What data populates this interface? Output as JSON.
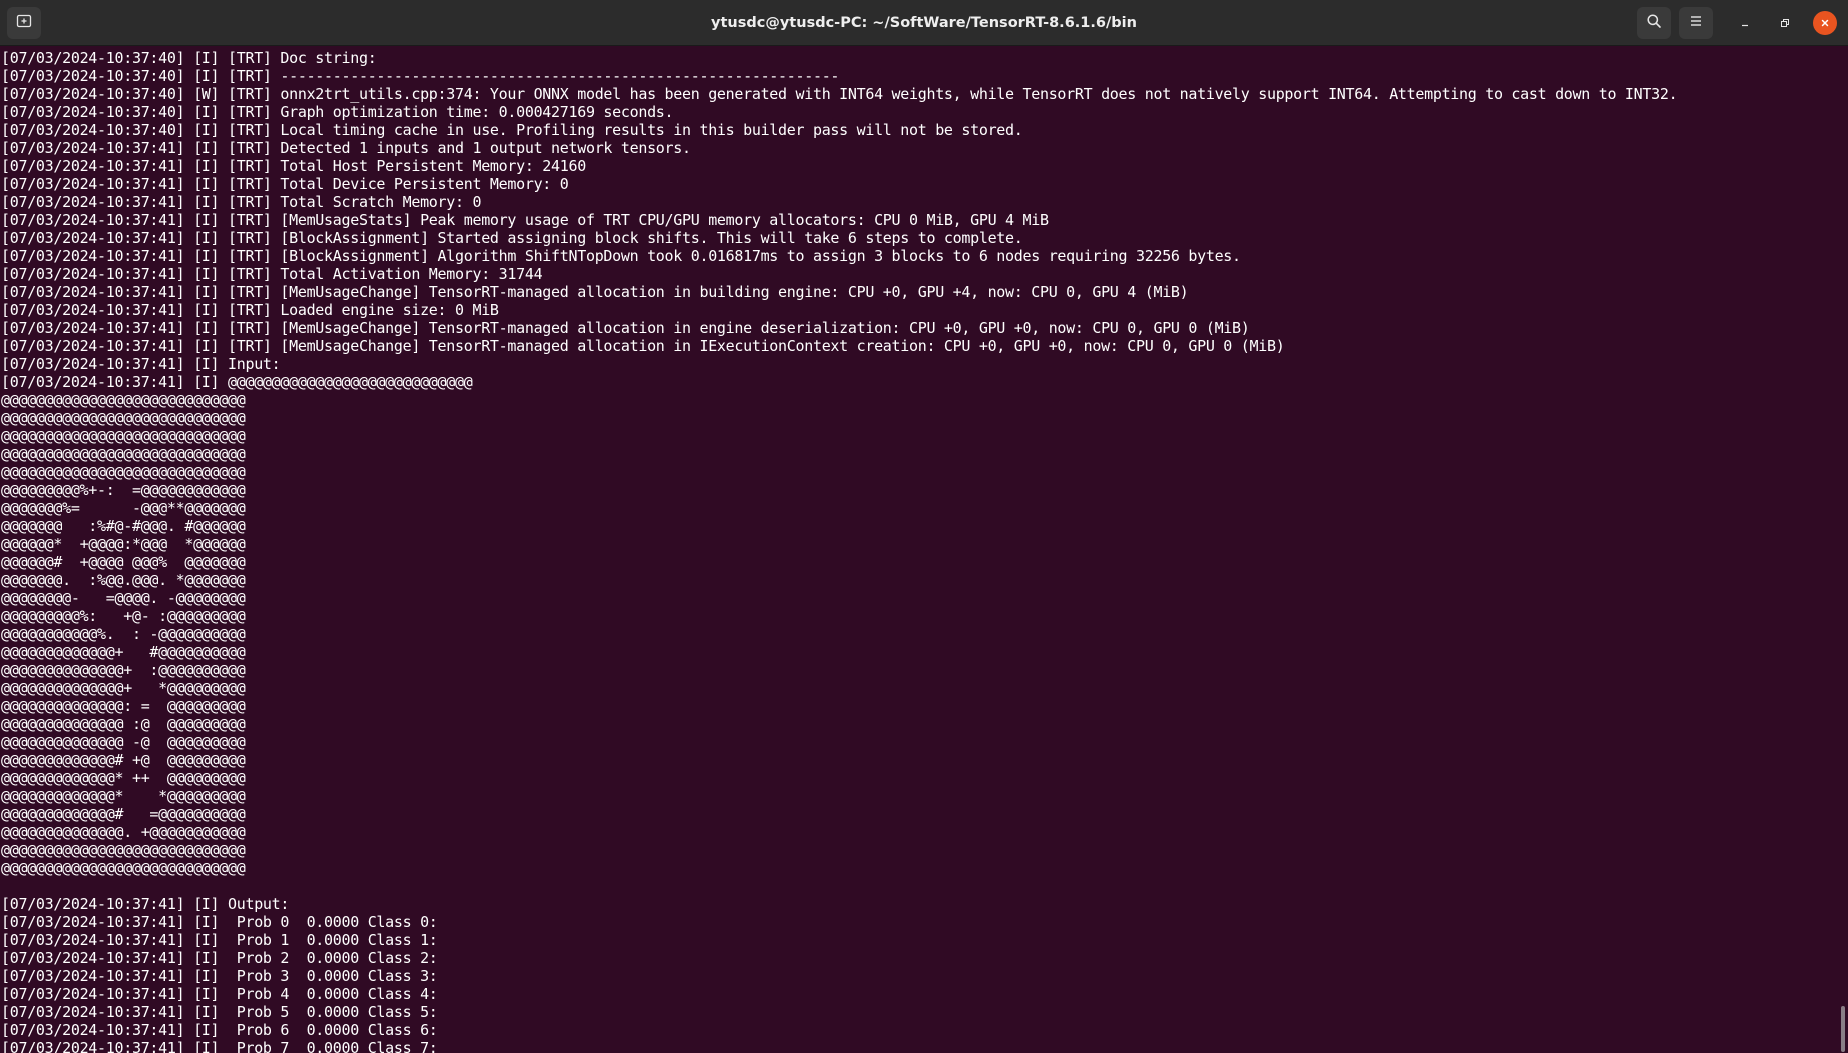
{
  "window": {
    "title": "ytusdc@ytusdc-PC: ~/SoftWare/TensorRT-8.6.1.6/bin"
  },
  "icons": {
    "new_tab": "new-tab-icon",
    "search": "search-icon",
    "menu": "hamburger-menu-icon",
    "minimize": "minimize-icon",
    "maximize": "maximize-icon",
    "close": "close-icon"
  },
  "colors": {
    "terminal_background": "#300a24",
    "titlebar_background": "#2c2c2c",
    "text": "#ffffff",
    "close_button": "#e95420"
  },
  "terminal": {
    "lines": [
      "[07/03/2024-10:37:40] [I] [TRT] Doc string:",
      "[07/03/2024-10:37:40] [I] [TRT] ----------------------------------------------------------------",
      "[07/03/2024-10:37:40] [W] [TRT] onnx2trt_utils.cpp:374: Your ONNX model has been generated with INT64 weights, while TensorRT does not natively support INT64. Attempting to cast down to INT32.",
      "[07/03/2024-10:37:40] [I] [TRT] Graph optimization time: 0.000427169 seconds.",
      "[07/03/2024-10:37:40] [I] [TRT] Local timing cache in use. Profiling results in this builder pass will not be stored.",
      "[07/03/2024-10:37:41] [I] [TRT] Detected 1 inputs and 1 output network tensors.",
      "[07/03/2024-10:37:41] [I] [TRT] Total Host Persistent Memory: 24160",
      "[07/03/2024-10:37:41] [I] [TRT] Total Device Persistent Memory: 0",
      "[07/03/2024-10:37:41] [I] [TRT] Total Scratch Memory: 0",
      "[07/03/2024-10:37:41] [I] [TRT] [MemUsageStats] Peak memory usage of TRT CPU/GPU memory allocators: CPU 0 MiB, GPU 4 MiB",
      "[07/03/2024-10:37:41] [I] [TRT] [BlockAssignment] Started assigning block shifts. This will take 6 steps to complete.",
      "[07/03/2024-10:37:41] [I] [TRT] [BlockAssignment] Algorithm ShiftNTopDown took 0.016817ms to assign 3 blocks to 6 nodes requiring 32256 bytes.",
      "[07/03/2024-10:37:41] [I] [TRT] Total Activation Memory: 31744",
      "[07/03/2024-10:37:41] [I] [TRT] [MemUsageChange] TensorRT-managed allocation in building engine: CPU +0, GPU +4, now: CPU 0, GPU 4 (MiB)",
      "[07/03/2024-10:37:41] [I] [TRT] Loaded engine size: 0 MiB",
      "[07/03/2024-10:37:41] [I] [TRT] [MemUsageChange] TensorRT-managed allocation in engine deserialization: CPU +0, GPU +0, now: CPU 0, GPU 0 (MiB)",
      "[07/03/2024-10:37:41] [I] [TRT] [MemUsageChange] TensorRT-managed allocation in IExecutionContext creation: CPU +0, GPU +0, now: CPU 0, GPU 0 (MiB)",
      "[07/03/2024-10:37:41] [I] Input:",
      "[07/03/2024-10:37:41] [I] @@@@@@@@@@@@@@@@@@@@@@@@@@@@",
      "@@@@@@@@@@@@@@@@@@@@@@@@@@@@",
      "@@@@@@@@@@@@@@@@@@@@@@@@@@@@",
      "@@@@@@@@@@@@@@@@@@@@@@@@@@@@",
      "@@@@@@@@@@@@@@@@@@@@@@@@@@@@",
      "@@@@@@@@@@@@@@@@@@@@@@@@@@@@",
      "@@@@@@@@@%+-:  =@@@@@@@@@@@@",
      "@@@@@@@%=      -@@@**@@@@@@@",
      "@@@@@@@   :%#@-#@@@. #@@@@@@",
      "@@@@@@*  +@@@@:*@@@  *@@@@@@",
      "@@@@@@#  +@@@@ @@@%  @@@@@@@",
      "@@@@@@@.  :%@@.@@@. *@@@@@@@",
      "@@@@@@@@-   =@@@@. -@@@@@@@@",
      "@@@@@@@@@%:   +@- :@@@@@@@@@",
      "@@@@@@@@@@@%.  : -@@@@@@@@@@",
      "@@@@@@@@@@@@@+   #@@@@@@@@@@",
      "@@@@@@@@@@@@@@+  :@@@@@@@@@@",
      "@@@@@@@@@@@@@@+   *@@@@@@@@@",
      "@@@@@@@@@@@@@@: =  @@@@@@@@@",
      "@@@@@@@@@@@@@@ :@  @@@@@@@@@",
      "@@@@@@@@@@@@@@ -@  @@@@@@@@@",
      "@@@@@@@@@@@@@# +@  @@@@@@@@@",
      "@@@@@@@@@@@@@* ++  @@@@@@@@@",
      "@@@@@@@@@@@@@*    *@@@@@@@@@",
      "@@@@@@@@@@@@@#   =@@@@@@@@@@",
      "@@@@@@@@@@@@@@. +@@@@@@@@@@@",
      "@@@@@@@@@@@@@@@@@@@@@@@@@@@@",
      "@@@@@@@@@@@@@@@@@@@@@@@@@@@@",
      "",
      "[07/03/2024-10:37:41] [I] Output:",
      "[07/03/2024-10:37:41] [I]  Prob 0  0.0000 Class 0:",
      "[07/03/2024-10:37:41] [I]  Prob 1  0.0000 Class 1:",
      "[07/03/2024-10:37:41] [I]  Prob 2  0.0000 Class 2:",
      "[07/03/2024-10:37:41] [I]  Prob 3  0.0000 Class 3:",
      "[07/03/2024-10:37:41] [I]  Prob 4  0.0000 Class 4:",
      "[07/03/2024-10:37:41] [I]  Prob 5  0.0000 Class 5:",
      "[07/03/2024-10:37:41] [I]  Prob 6  0.0000 Class 6:",
      "[07/03/2024-10:37:41] [I]  Prob 7  0.0000 Class 7:"
    ]
  }
}
